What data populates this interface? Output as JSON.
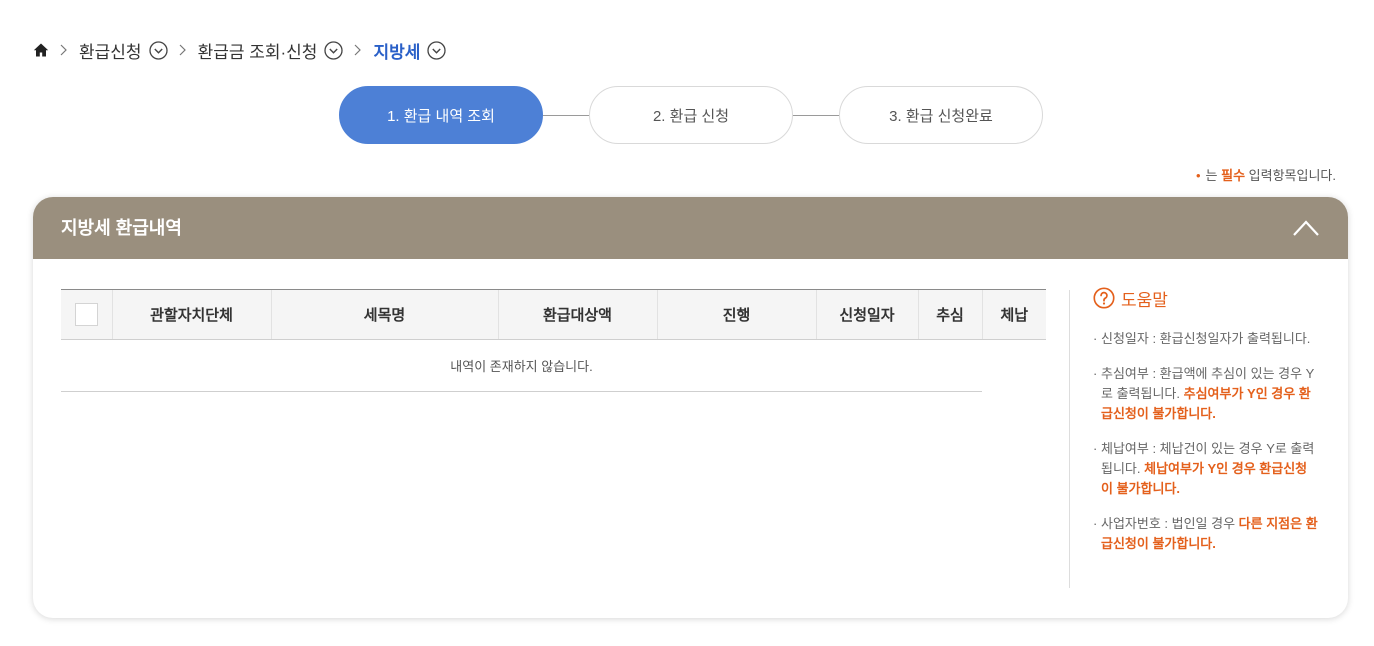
{
  "breadcrumb": {
    "home_icon": "home-icon",
    "separator_icon": "chevron-right-icon",
    "items": [
      {
        "label": "환급신청",
        "icon": "circle-chevron-down-icon",
        "current": false
      },
      {
        "label": "환급금 조회·신청",
        "icon": "circle-chevron-down-icon",
        "current": false
      },
      {
        "label": "지방세",
        "icon": "circle-chevron-down-icon",
        "current": true
      }
    ]
  },
  "steps": [
    {
      "label": "1. 환급 내역 조회",
      "active": true
    },
    {
      "label": "2. 환급 신청",
      "active": false
    },
    {
      "label": "3. 환급 신청완료",
      "active": false
    }
  ],
  "required_note": {
    "bullet": "•",
    "prefix": "는 ",
    "emphasis": "필수",
    "suffix": " 입력항목입니다."
  },
  "panel": {
    "title": "지방세 환급내역",
    "collapse_icon": "chevron-up-icon",
    "table": {
      "select_all": false,
      "columns": [
        "관할자치단체",
        "세목명",
        "환급대상액",
        "진행",
        "신청일자",
        "추심",
        "체납"
      ],
      "empty_message": "내역이 존재하지 않습니다."
    },
    "help": {
      "icon": "question-circle-icon",
      "title": "도움말",
      "bullet": "·",
      "items": [
        {
          "text": "신청일자 : 환급신청일자가 출력됩니다."
        },
        {
          "text": "추심여부 : 환급액에 추심이 있는 경우 Y로 출력됩니다. ",
          "emphasis": "추심여부가 Y인 경우 환급신청이 불가합니다."
        },
        {
          "text": "체납여부 : 체납건이 있는 경우 Y로 출력됩니다. ",
          "emphasis": "체납여부가 Y인 경우 환급신청이 불가합니다."
        },
        {
          "text": "사업자번호 : 법인일 경우 ",
          "emphasis": "다른 지점은 환급신청이 불가합니다."
        }
      ]
    }
  },
  "colors": {
    "accent_blue": "#4d80d6",
    "breadcrumb_current": "#2a60c8",
    "panel_header": "#9a8f7e",
    "emphasis_orange": "#e4601c"
  }
}
